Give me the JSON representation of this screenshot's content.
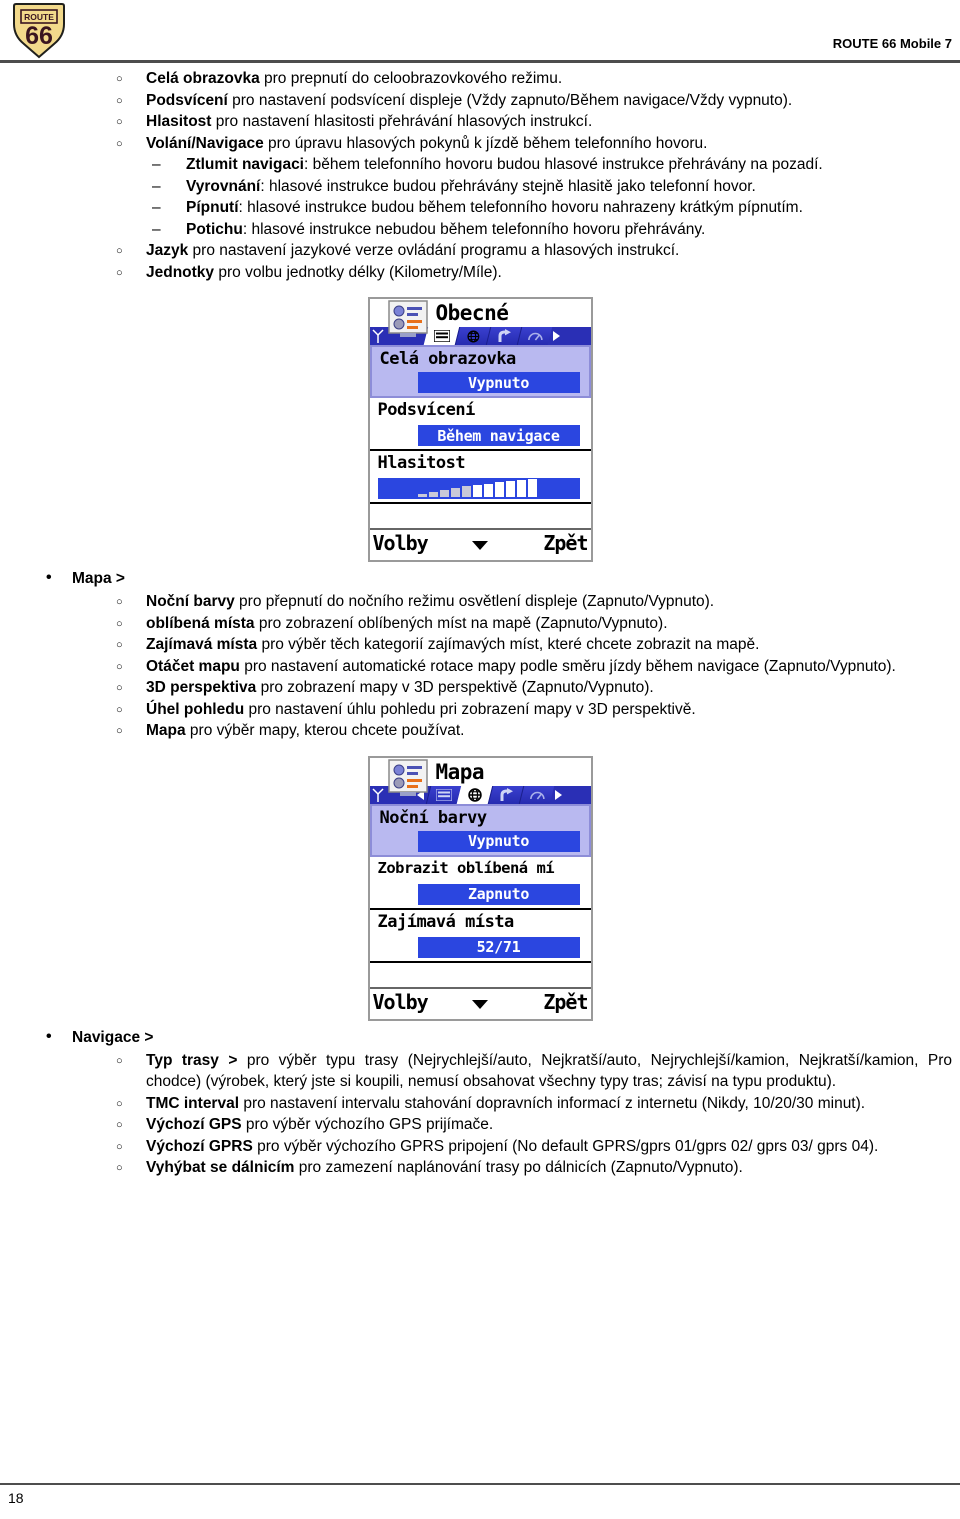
{
  "header": {
    "logo_alt": "route-66-logo",
    "logo_top_text": "ROUTE",
    "logo_number": "66",
    "title": "ROUTE 66 Mobile 7"
  },
  "footer": {
    "page_number": "18"
  },
  "content": {
    "general_items": [
      {
        "term": "Celá obrazovka",
        "rest": " pro prepnutí do celoobrazovkového režimu."
      },
      {
        "term": "Podsvícení",
        "rest": " pro nastavení podsvícení displeje (Vždy zapnuto/Během navigace/Vždy vypnuto)."
      },
      {
        "term": "Hlasitost",
        "rest": " pro nastavení hlasitosti přehrávání hlasových instrukcí."
      },
      {
        "term": "Volání/Navigace",
        "rest": " pro úpravu hlasových pokynů k jízdě během telefonního hovoru."
      }
    ],
    "call_nav_subitems": [
      {
        "term": "Ztlumit navigaci",
        "rest": ": během telefonního hovoru budou hlasové instrukce přehrávány na pozadí."
      },
      {
        "term": "Vyrovnání",
        "rest": ": hlasové instrukce budou přehrávány stejně hlasitě jako telefonní hovor."
      },
      {
        "term": "Pípnutí",
        "rest": ": hlasové instrukce budou během telefonního hovoru nahrazeny krátkým pípnutím."
      },
      {
        "term": "Potichu",
        "rest": ": hlasové instrukce nebudou během telefonního hovoru přehrávány."
      }
    ],
    "general_items_tail": [
      {
        "term": "Jazyk",
        "rest": " pro nastavení jazykové verze ovládání programu a hlasových instrukcí."
      },
      {
        "term": "Jednotky",
        "rest": " pro volbu jednotky délky (Kilometry/Míle)."
      }
    ],
    "map_section": {
      "heading": "Mapa >",
      "items": [
        {
          "term": "Noční barvy",
          "rest": " pro přepnutí do nočního režimu osvětlení displeje (Zapnuto/Vypnuto)."
        },
        {
          "term": "oblíbená místa",
          "rest": " pro zobrazení oblíbených míst na mapě (Zapnuto/Vypnuto)."
        },
        {
          "term": "Zajímavá místa",
          "rest": " pro výběr těch kategorií zajímavých míst, které chcete zobrazit na mapě."
        },
        {
          "term": "Otáčet mapu",
          "rest": " pro nastavení automatické rotace mapy podle směru jízdy během navigace (Zapnuto/Vypnuto)."
        },
        {
          "term": "3D perspektiva",
          "rest": " pro zobrazení mapy v 3D perspektivě (Zapnuto/Vypnuto)."
        },
        {
          "term": "Úhel pohledu",
          "rest": " pro nastavení úhlu pohledu pri zobrazení mapy v 3D perspektivě."
        },
        {
          "term": "Mapa",
          "rest": " pro výběr mapy, kterou chcete používat."
        }
      ]
    },
    "navigation_section": {
      "heading": "Navigace >",
      "items": [
        {
          "term": "Typ trasy >",
          "rest": " pro výběr typu trasy (Nejrychlejší/auto, Nejkratší/auto, Nejrychlejší/kamion, Nejkratší/kamion, Pro chodce) (výrobek, který jste si koupili, nemusí obsahovat všechny typy tras; závisí na typu produktu)."
        },
        {
          "term": "TMC interval",
          "rest": " pro nastavení intervalu stahování dopravních informací z internetu (Nikdy, 10/20/30 minut)."
        },
        {
          "term": "Výchozí GPS",
          "rest": " pro výběr výchozího GPS prijímače."
        },
        {
          "term": "Výchozí GPRS",
          "rest": " pro výběr výchozího GPRS pripojení (No default GPRS/gprs 01/gprs 02/ gprs 03/ gprs 04)."
        },
        {
          "term": "Vyhýbat se dálnicím",
          "rest": " pro zamezení naplánování trasy po dálnicích (Zapnuto/Vypnuto)."
        }
      ]
    }
  },
  "device_screenshot_general": {
    "title": "Obecné",
    "app_icon": "settings-list-icon",
    "signal_icon": "signal-antenna-icon",
    "tabs": [
      {
        "icon": "list-tab-icon",
        "active": true
      },
      {
        "icon": "globe-tab-icon",
        "active": false
      },
      {
        "icon": "turn-arrow-tab-icon",
        "active": false
      },
      {
        "icon": "gauge-tab-icon",
        "active": false
      }
    ],
    "tab_arrow_right": "chevron-right-icon",
    "rows": [
      {
        "label": "Celá obrazovka",
        "value": "Vypnuto",
        "selected": true,
        "type": "value"
      },
      {
        "label": "Podsvícení",
        "value": "Během navigace",
        "selected": false,
        "type": "value"
      },
      {
        "label": "Hlasitost",
        "value": "",
        "selected": false,
        "type": "meter",
        "meter_level": 6,
        "meter_total": 11
      }
    ],
    "softkey_left": "Volby",
    "softkey_right": "Zpět",
    "softkey_mid_icon": "chevron-down-icon"
  },
  "device_screenshot_map": {
    "title": "Mapa",
    "app_icon": "settings-list-icon",
    "signal_icon": "signal-antenna-icon",
    "tab_arrow_left": "chevron-left-icon",
    "tabs": [
      {
        "icon": "list-tab-icon",
        "active": false
      },
      {
        "icon": "globe-tab-icon",
        "active": true
      },
      {
        "icon": "turn-arrow-tab-icon",
        "active": false
      },
      {
        "icon": "gauge-tab-icon",
        "active": false
      }
    ],
    "tab_arrow_right": "chevron-right-icon",
    "rows": [
      {
        "label": "Noční barvy",
        "value": "Vypnuto",
        "selected": true,
        "type": "value"
      },
      {
        "label": "Zobrazit oblíbená mí",
        "value": "Zapnuto",
        "selected": false,
        "type": "value"
      },
      {
        "label": "Zajímavá místa",
        "value": "52/71",
        "selected": false,
        "type": "value"
      }
    ],
    "softkey_left": "Volby",
    "softkey_right": "Zpět",
    "softkey_mid_icon": "chevron-down-icon"
  },
  "colors": {
    "rule": "#4d4d4d",
    "device_tab_blue": "#2a2fb5",
    "device_value_blue": "#2b46e0",
    "device_selected_bg": "#b9b9f0",
    "logo_yellow": "#f2d98b",
    "logo_dark": "#3a1520"
  }
}
